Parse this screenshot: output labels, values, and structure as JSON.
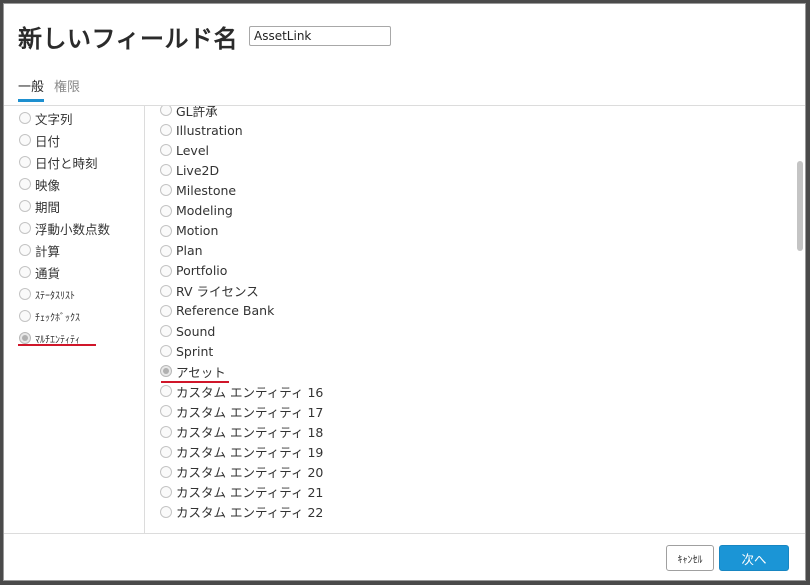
{
  "dialog": {
    "title": "新しいフィールド名",
    "name_value": "AssetLink"
  },
  "tabs": [
    {
      "label": "一般",
      "active": true
    },
    {
      "label": "権限",
      "active": false
    }
  ],
  "left_types": [
    {
      "label": "文字列",
      "checked": false
    },
    {
      "label": "日付",
      "checked": false
    },
    {
      "label": "日付と時刻",
      "checked": false
    },
    {
      "label": "映像",
      "checked": false
    },
    {
      "label": "期間",
      "checked": false
    },
    {
      "label": "浮動小数点数",
      "checked": false
    },
    {
      "label": "計算",
      "checked": false
    },
    {
      "label": "通貨",
      "checked": false
    },
    {
      "label": "ｽﾃｰﾀｽﾘｽﾄ",
      "checked": false
    },
    {
      "label": "ﾁｪｯｸﾎﾞｯｸｽ",
      "checked": false
    },
    {
      "label": "ﾏﾙﾁｴﾝﾃｨﾃｨ",
      "checked": true
    }
  ],
  "right_entities": [
    {
      "label": "GL許承",
      "checked": false
    },
    {
      "label": "Illustration",
      "checked": false
    },
    {
      "label": "Level",
      "checked": false
    },
    {
      "label": "Live2D",
      "checked": false
    },
    {
      "label": "Milestone",
      "checked": false
    },
    {
      "label": "Modeling",
      "checked": false
    },
    {
      "label": "Motion",
      "checked": false
    },
    {
      "label": "Plan",
      "checked": false
    },
    {
      "label": "Portfolio",
      "checked": false
    },
    {
      "label": "RV ライセンス",
      "checked": false
    },
    {
      "label": "Reference Bank",
      "checked": false
    },
    {
      "label": "Sound",
      "checked": false
    },
    {
      "label": "Sprint",
      "checked": false
    },
    {
      "label": "アセット",
      "checked": true
    },
    {
      "label": "カスタム エンティティ 16",
      "checked": false
    },
    {
      "label": "カスタム エンティティ 17",
      "checked": false
    },
    {
      "label": "カスタム エンティティ 18",
      "checked": false
    },
    {
      "label": "カスタム エンティティ 19",
      "checked": false
    },
    {
      "label": "カスタム エンティティ 20",
      "checked": false
    },
    {
      "label": "カスタム エンティティ 21",
      "checked": false
    },
    {
      "label": "カスタム エンティティ 22",
      "checked": false
    }
  ],
  "footer": {
    "cancel_label": "ｷｬﾝｾﾙ",
    "next_label": "次へ"
  },
  "colors": {
    "accent": "#1b95d6",
    "highlight_underline": "#d0162a"
  }
}
